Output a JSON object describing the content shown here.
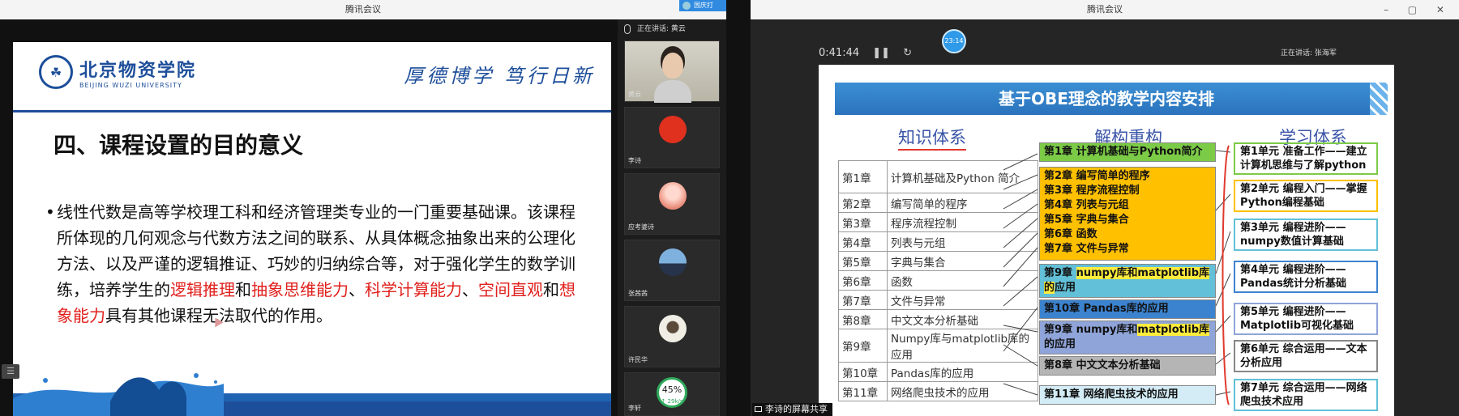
{
  "left_window": {
    "title": "腾讯会议",
    "speaking": "正在讲话: 黄云",
    "corner_app": "国庆打",
    "slide": {
      "university_cn": "北京物资学院",
      "university_en": "BEIJING WUZI UNIVERSITY",
      "motto": "厚德博学 笃行日新",
      "heading": "四、课程设置的目的意义",
      "body": {
        "bullet": "•",
        "p1": "线性代数是高等学校理工科和经济管理类专业的一门重要基础课。该课程所体现的几何观念与代数方法之间的联系、从具体概念抽象出来的公理化方法、以及严谨的逻辑推证、巧妙的归纳综合等，对于强化学生的数学训练，培养学生的",
        "r1": "逻辑推理",
        "and1": "和",
        "r2": "抽象思维能力",
        "sep1": "、",
        "r3": "科学计算能力",
        "sep2": "、",
        "r4": "空间直观",
        "and2": "和",
        "r5": "想象能力",
        "p2": "具有其他课程无法取代的作用。"
      }
    },
    "participants": [
      {
        "name": "黄云"
      },
      {
        "name": "李诗"
      },
      {
        "name": "应考婆诗"
      },
      {
        "name": "张茜茜"
      },
      {
        "name": "许民华"
      },
      {
        "name": "李轩"
      }
    ],
    "progress": {
      "value": "45%",
      "sub": "↑ 29k/s"
    }
  },
  "right_window": {
    "title": "腾讯会议",
    "timer": "0:41:44",
    "pause_icon": "❚❚",
    "refresh_icon": "↻",
    "bubble": "23:14",
    "speaking": "正在讲话: 张海军",
    "share_label": "李诗的屏幕共享",
    "slide": {
      "banner": "基于OBE理念的教学内容安排",
      "col1": "知识体系",
      "col2": "解构重构",
      "col3": "学习体系",
      "knowledge": [
        {
          "ch": "第1章",
          "name": "计算机基础及Python 简介"
        },
        {
          "ch": "第2章",
          "name": "编写简单的程序"
        },
        {
          "ch": "第3章",
          "name": "程序流程控制"
        },
        {
          "ch": "第4章",
          "name": "列表与元组"
        },
        {
          "ch": "第5章",
          "name": "字典与集合"
        },
        {
          "ch": "第6章",
          "name": "函数"
        },
        {
          "ch": "第7章",
          "name": "文件与异常"
        },
        {
          "ch": "第8章",
          "name": "中文文本分析基础"
        },
        {
          "ch": "第9章",
          "name": "Numpy库与matplotlib库的应用"
        },
        {
          "ch": "第10章",
          "name": "Pandas库的应用"
        },
        {
          "ch": "第11章",
          "name": "网络爬虫技术的应用"
        }
      ],
      "restructure": {
        "b1": "第1章 计算机基础与Python简介",
        "b2": [
          "第2章 编写简单的程序",
          "第3章 程序流程控制",
          "第4章 列表与元组",
          "第5章 字典与集合",
          "第6章 函数",
          "第7章 文件与异常"
        ],
        "b3_pre": "第9章 ",
        "b3_hl": "numpy库和matplotlib库的",
        "b3_post": "应用",
        "b4": "第10章 Pandas库的应用",
        "b5_pre": "第9章 numpy库和",
        "b5_hl": "matplotlib库",
        "b5_post": "的应用",
        "b6": "第8章 中文文本分析基础",
        "b7": "第11章 网络爬虫技术的应用"
      },
      "learning": [
        "第1单元 准备工作——建立计算机思维与了解python",
        "第2单元 编程入门——掌握Python编程基础",
        "第3单元 编程进阶——numpy数值计算基础",
        "第4单元 编程进阶——Pandas统计分析基础",
        "第5单元 编程进阶——Matplotlib可视化基础",
        "第6单元 综合运用——文本分析应用",
        "第7单元 综合运用——网络爬虫技术应用"
      ]
    }
  },
  "colors": {
    "brand_blue": "#1d4e9a",
    "accent_red": "#e0201c",
    "highlight": "#ffec3d"
  }
}
